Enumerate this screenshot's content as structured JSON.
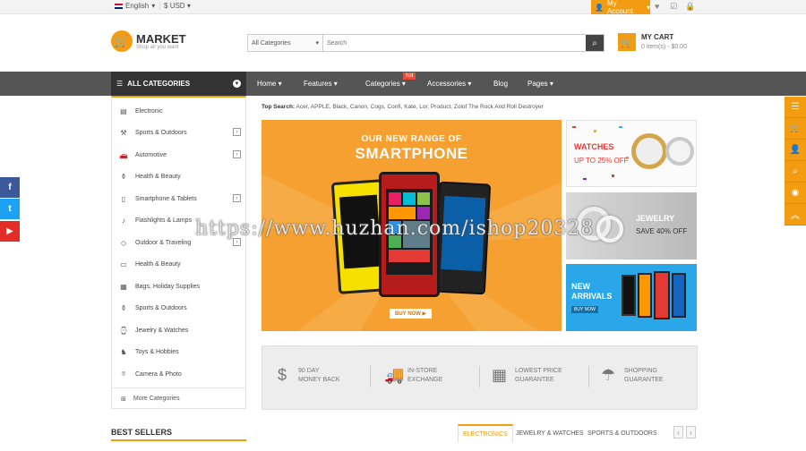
{
  "topbar": {
    "language": "English",
    "currency": "USD",
    "account_label": "My Account"
  },
  "header": {
    "logo_name": "MARKET",
    "logo_tagline": "Shop all you want",
    "search_category": "All Categories",
    "search_placeholder": "Search",
    "cart_title": "MY CART",
    "cart_summary": "0 item(s) - $0.00"
  },
  "nav": {
    "all_categories": "ALL CATEGORIES",
    "items": [
      "Home",
      "Features",
      "Categories",
      "Accessories",
      "Blog",
      "Pages"
    ],
    "hot_badge": "hot"
  },
  "sidebar": {
    "items": [
      {
        "label": "Electronic",
        "icon": "document-icon",
        "has_sub": false
      },
      {
        "label": "Sports & Outdoors",
        "icon": "sports-icon",
        "has_sub": true
      },
      {
        "label": "Automotive",
        "icon": "car-icon",
        "has_sub": true
      },
      {
        "label": "Health & Beauty",
        "icon": "bottle-icon",
        "has_sub": false
      },
      {
        "label": "Smartphone & Tablets",
        "icon": "phone-icon",
        "has_sub": true
      },
      {
        "label": "Flashlights & Lamps",
        "icon": "lamp-icon",
        "has_sub": false
      },
      {
        "label": "Outdoor & Traveling",
        "icon": "diamond-icon",
        "has_sub": true
      },
      {
        "label": "Health & Beauty",
        "icon": "laptop-icon",
        "has_sub": false
      },
      {
        "label": "Bags, Holiday Supplies",
        "icon": "bag-icon",
        "has_sub": false
      },
      {
        "label": "Sports & Outdoors",
        "icon": "bottle-icon",
        "has_sub": false
      },
      {
        "label": "Jewelry & Watches",
        "icon": "watch-icon",
        "has_sub": false
      },
      {
        "label": "Toys & Hobbies",
        "icon": "toy-icon",
        "has_sub": false
      },
      {
        "label": "Camera & Photo",
        "icon": "camera-icon",
        "has_sub": false
      }
    ],
    "more": "More Categories"
  },
  "top_search": {
    "label": "Top Search:",
    "terms": "Acer, APPLE, Black, Canon, Cogs, Confi, Kate, Lor, Product, Zolof The Rock And Roll Destroyer"
  },
  "main_banner": {
    "line1": "OUR NEW RANGE OF",
    "line2": "SMARTPHONE",
    "buy_now": "BUY NOW ▶"
  },
  "side_banners": {
    "watches_title": "WATCHES",
    "watches_offer": "UP TO 25% OFF",
    "jewelry_title": "JEWELRY",
    "jewelry_offer": "SAVE 40% OFF",
    "arrivals_line1": "NEW",
    "arrivals_line2": "ARRIVALS",
    "arrivals_cta": "BUY NOW"
  },
  "features": [
    {
      "line1": "90 DAY",
      "line2": "MONEY BACK",
      "icon": "dollar-icon"
    },
    {
      "line1": "IN-STORE",
      "line2": "EXCHANGE",
      "icon": "truck-icon"
    },
    {
      "line1": "LOWEST PRICE",
      "line2": "GUARANTEE",
      "icon": "calendar-icon"
    },
    {
      "line1": "SHOPPING",
      "line2": "GUARANTEE",
      "icon": "umbrella-icon"
    }
  ],
  "bottom": {
    "best_sellers": "BEST SELLERS",
    "tabs": [
      "ELECTRONICS",
      "JEWELRY & WATCHES",
      "SPORTS & OUTDOORS"
    ]
  },
  "social": [
    "f",
    "t",
    "▶"
  ],
  "watermark": "https://www.huzhan.com/ishop20328",
  "colors": {
    "accent": "#f39c12",
    "nav": "#555555",
    "nav_dark": "#333333"
  }
}
